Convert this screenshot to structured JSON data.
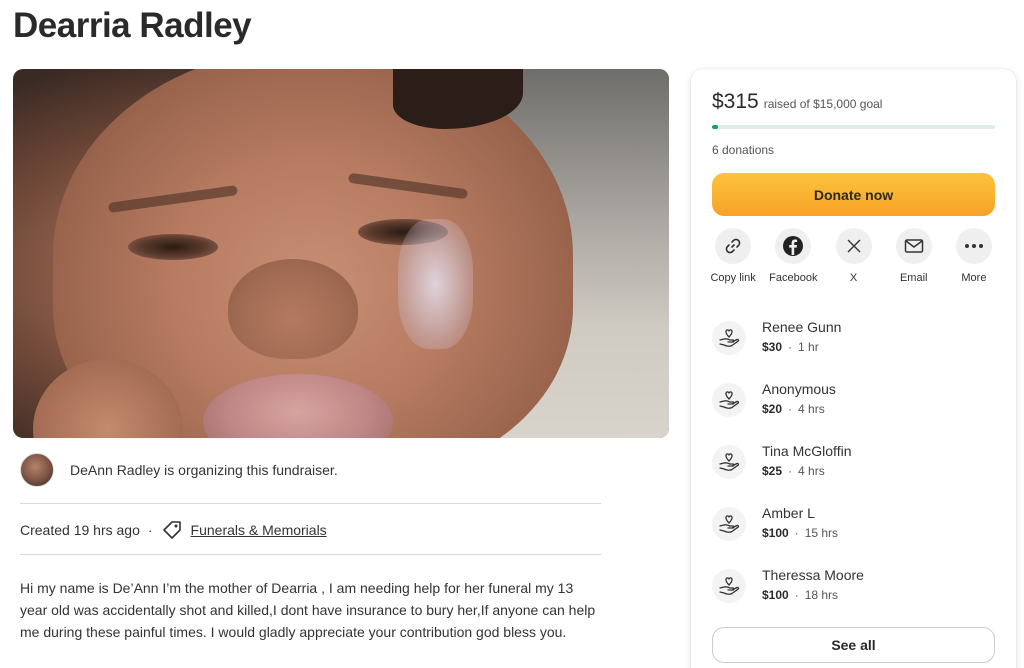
{
  "page": {
    "title": "Dearria Radley"
  },
  "organizer": {
    "text": "DeAnn Radley is organizing this fundraiser."
  },
  "meta": {
    "created": "Created 19 hrs ago",
    "dot": "·",
    "category": "Funerals & Memorials"
  },
  "story": {
    "text": "Hi my name is De’Ann I’m the mother of Dearria , I am needing help for her funeral my 13 year old was accidentally shot and killed,I dont have insurance to bury her,If anyone can help me during these painful times. I would gladly appreciate your contribution god bless you."
  },
  "card": {
    "raised_amount": "$315",
    "raised_goal": "raised of $15,000 goal",
    "progress_fraction": 0.021,
    "donations_count": "6 donations",
    "donate_label": "Donate now",
    "see_all_label": "See all"
  },
  "share": [
    {
      "label": "Copy link",
      "icon": "link-icon"
    },
    {
      "label": "Facebook",
      "icon": "facebook-icon"
    },
    {
      "label": "X",
      "icon": "x-icon"
    },
    {
      "label": "Email",
      "icon": "email-icon"
    },
    {
      "label": "More",
      "icon": "more-icon"
    }
  ],
  "donors": [
    {
      "name": "Renee Gunn",
      "amount": "$30",
      "time": "1 hr"
    },
    {
      "name": "Anonymous",
      "amount": "$20",
      "time": "4 hrs"
    },
    {
      "name": "Tina McGloffin",
      "amount": "$25",
      "time": "4 hrs"
    },
    {
      "name": "Amber L",
      "amount": "$100",
      "time": "15 hrs"
    },
    {
      "name": "Theressa Moore",
      "amount": "$100",
      "time": "18 hrs"
    }
  ],
  "separator": "·",
  "colors": {
    "accent_green": "#02a95c",
    "donate_orange": "#f7a226"
  }
}
